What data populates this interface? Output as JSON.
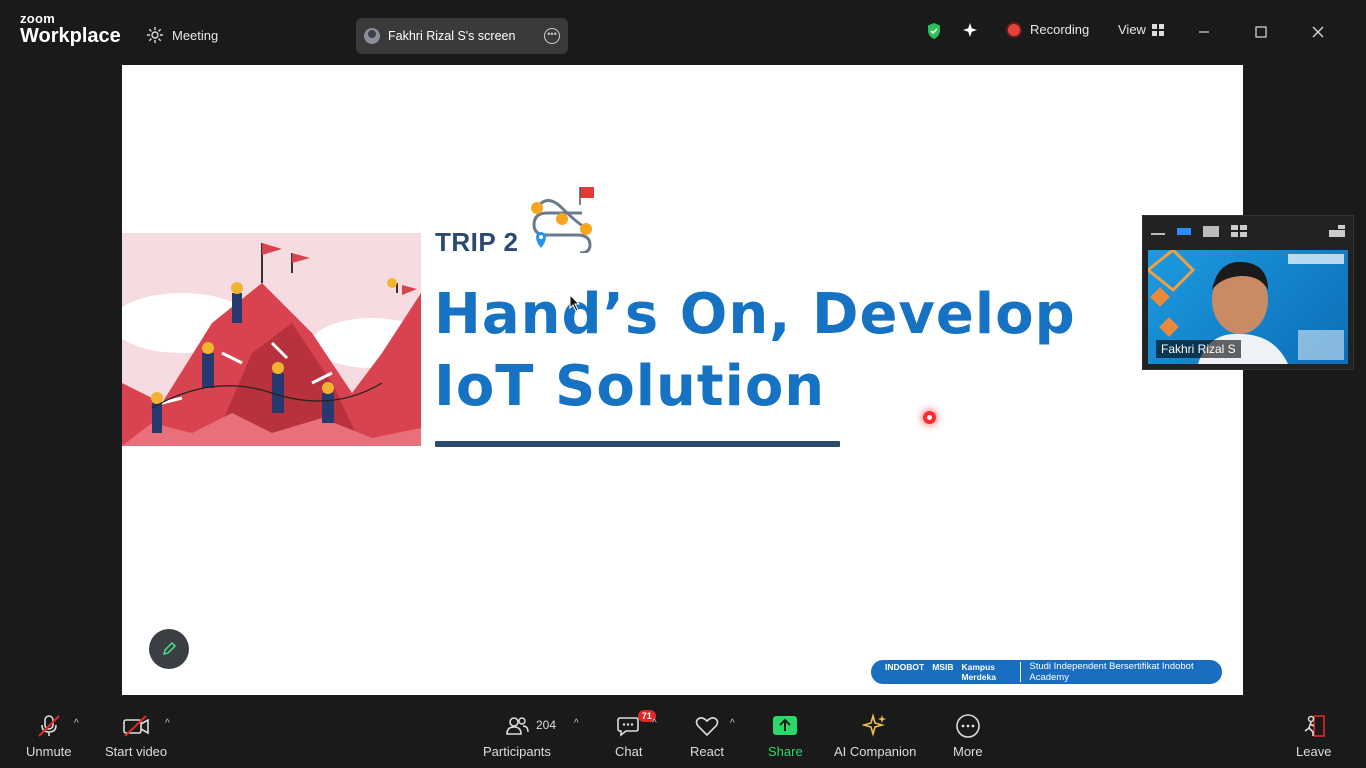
{
  "app": {
    "logo_top": "zoom",
    "logo_bottom": "Workplace",
    "meeting_label": "Meeting",
    "screen_share_label": "Fakhri Rizal S's screen",
    "recording_label": "Recording",
    "view_label": "View"
  },
  "slide": {
    "trip_label": "TRIP 2",
    "headline_line1": "Hand’s On, Develop",
    "headline_line2": "IoT Solution",
    "footer_logo1": "INDOBOT",
    "footer_logo2": "MSIB",
    "footer_logo3": "Kampus Merdeka",
    "footer_text": "Studi Independent Bersertifikat Indobot Academy"
  },
  "thumbnail": {
    "participant_name": "Fakhri Rizal S"
  },
  "toolbar": {
    "unmute": "Unmute",
    "start_video": "Start video",
    "participants": "Participants",
    "participants_count": "204",
    "chat": "Chat",
    "chat_badge": "71",
    "react": "React",
    "share": "Share",
    "ai_companion": "AI Companion",
    "more": "More",
    "leave": "Leave"
  },
  "colors": {
    "accent_blue": "#1673c3",
    "navy": "#2c4a6e",
    "share_green": "#2bd96b",
    "danger_red": "#e02828"
  }
}
